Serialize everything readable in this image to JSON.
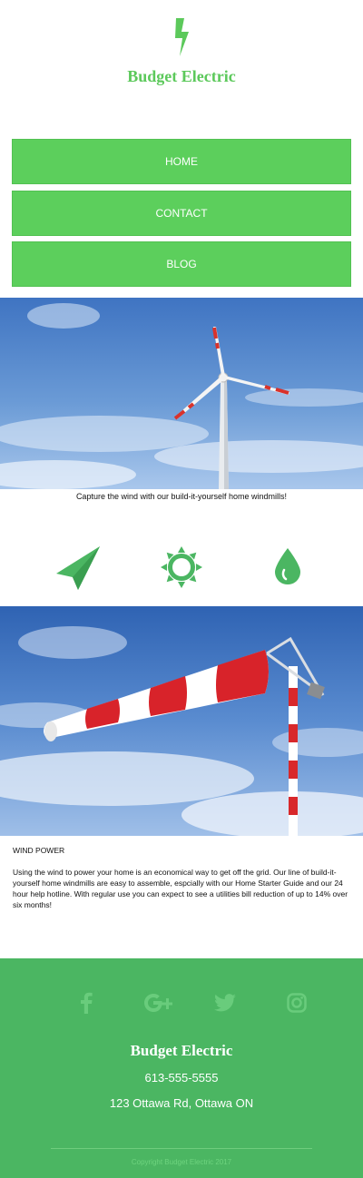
{
  "brand": {
    "name": "Budget Electric",
    "logo_icon": "lightning-bolt-icon",
    "color": "#5cc95b"
  },
  "nav": {
    "items": [
      {
        "label": "HOME"
      },
      {
        "label": "CONTACT"
      },
      {
        "label": "BLOG"
      }
    ],
    "color": "#5ccf5c"
  },
  "hero": {
    "image": "wind-turbine-photo",
    "caption": "Capture the wind with our build-it-yourself home windmills!"
  },
  "features": {
    "icons": [
      "paper-plane-icon",
      "sun-icon",
      "water-drop-icon"
    ],
    "color": "#4bb662"
  },
  "section": {
    "image": "windsock-photo",
    "title": "WIND POWER",
    "body": "Using the wind to power your home is an economical way to get off the grid. Our line of build-it-yourself home windmills are easy to assemble, espcially with our Home Starter Guide and our 24 hour help hotline. With regular use you can expect to see a utilities bill reduction of up to 14% over six months!"
  },
  "footer": {
    "social_icons": [
      "facebook-icon",
      "google-plus-icon",
      "twitter-icon",
      "instagram-icon"
    ],
    "brand": "Budget Electric",
    "phone": "613-555-5555",
    "address": "123 Ottawa Rd, Ottawa ON",
    "copyright": "Copyright Budget Electric 2017",
    "background": "#4bb662"
  }
}
